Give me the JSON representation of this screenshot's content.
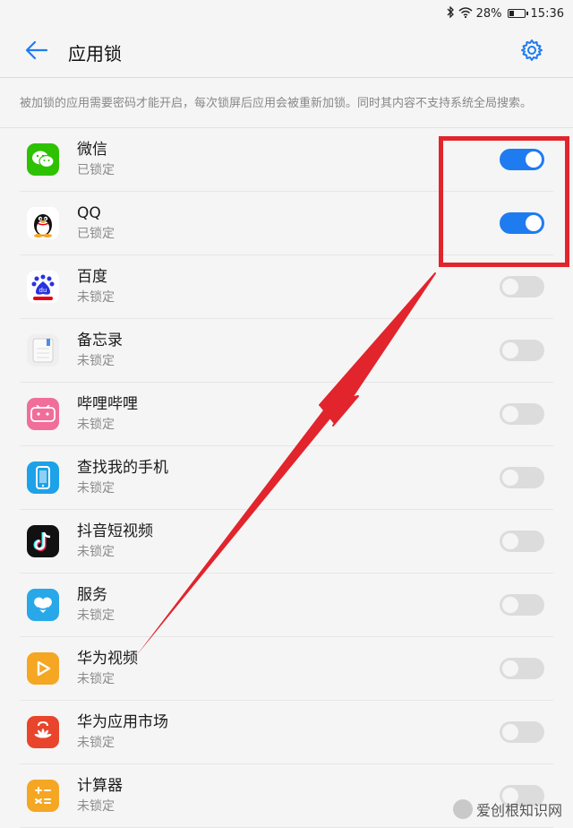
{
  "status_bar": {
    "battery": "28%",
    "time": "15:36"
  },
  "header": {
    "title": "应用锁",
    "back_icon": "arrow-left-icon",
    "settings_icon": "gear-icon"
  },
  "description": "被加锁的应用需要密码才能开启，每次锁屏后应用会被重新加锁。同时其内容不支持系统全局搜索。",
  "apps": [
    {
      "name": "微信",
      "status": "已锁定",
      "locked": true,
      "icon": "wechat-icon",
      "color": "#2dc100"
    },
    {
      "name": "QQ",
      "status": "已锁定",
      "locked": true,
      "icon": "qq-icon",
      "color": "#ffffff"
    },
    {
      "name": "百度",
      "status": "未锁定",
      "locked": false,
      "icon": "baidu-icon",
      "color": "#ffffff"
    },
    {
      "name": "备忘录",
      "status": "未锁定",
      "locked": false,
      "icon": "notepad-icon",
      "color": "#eeeeee"
    },
    {
      "name": "哔哩哔哩",
      "status": "未锁定",
      "locked": false,
      "icon": "bilibili-icon",
      "color": "#f06e99"
    },
    {
      "name": "查找我的手机",
      "status": "未锁定",
      "locked": false,
      "icon": "find-phone-icon",
      "color": "#1da1e8"
    },
    {
      "name": "抖音短视频",
      "status": "未锁定",
      "locked": false,
      "icon": "douyin-icon",
      "color": "#111111"
    },
    {
      "name": "服务",
      "status": "未锁定",
      "locked": false,
      "icon": "service-heart-icon",
      "color": "#28a8e8"
    },
    {
      "name": "华为视频",
      "status": "未锁定",
      "locked": false,
      "icon": "play-icon",
      "color": "#f5a623"
    },
    {
      "name": "华为应用市场",
      "status": "未锁定",
      "locked": false,
      "icon": "huawei-appgallery-icon",
      "color": "#e8452c"
    },
    {
      "name": "计算器",
      "status": "未锁定",
      "locked": false,
      "icon": "calculator-icon",
      "color": "#f5a623"
    }
  ],
  "watermark": "爱创根知识网",
  "annotation_color": "#e2242c",
  "accent_color": "#1e7cf0"
}
